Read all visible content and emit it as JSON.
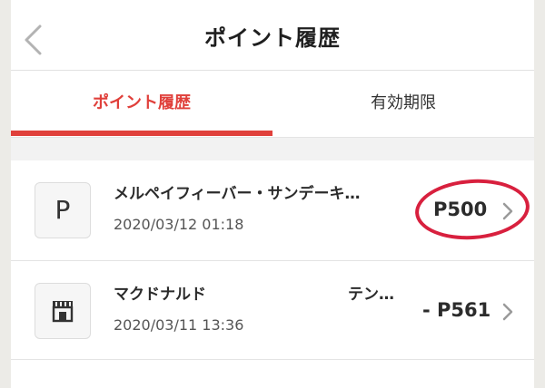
{
  "header": {
    "title": "ポイント履歴"
  },
  "tabs": [
    {
      "label": "ポイント履歴",
      "active": true
    },
    {
      "label": "有効期限",
      "active": false
    }
  ],
  "transactions": [
    {
      "icon": "P",
      "title": "メルペイフィーバー・サンデーキ…",
      "date": "2020/03/12 01:18",
      "amount": "P500",
      "highlighted": true
    },
    {
      "icon": "store-icon",
      "title_start": "マクドナルド",
      "title_end": "テン…",
      "date": "2020/03/11 13:36",
      "amount": "- P561",
      "highlighted": false
    }
  ],
  "colors": {
    "accent": "#e0403b",
    "highlight_circle": "#d8203e"
  }
}
